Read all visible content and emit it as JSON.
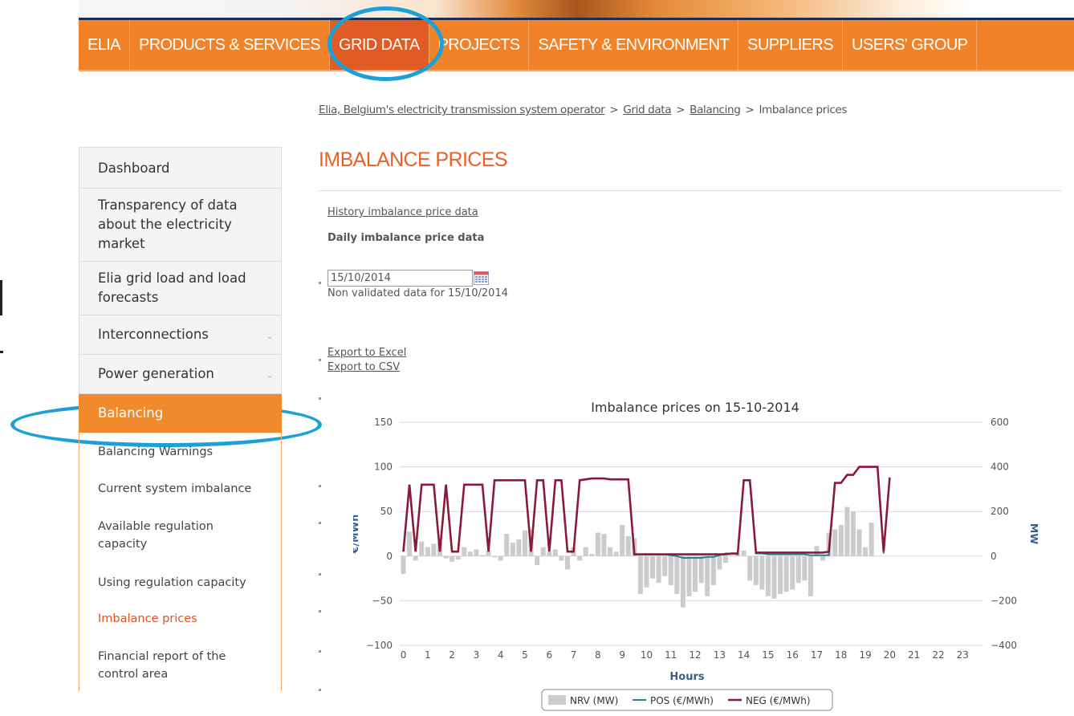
{
  "nav": {
    "items": [
      "ELIA",
      "PRODUCTS & SERVICES",
      "GRID DATA",
      "PROJECTS",
      "SAFETY & ENVIRONMENT",
      "SUPPLIERS",
      "USERS' GROUP"
    ],
    "active_index": 2
  },
  "breadcrumb": {
    "home": "Elia, Belgium's electricity transmission system operator",
    "grid_data": "Grid data",
    "balancing": "Balancing",
    "current": "Imbalance prices",
    "separator": ">"
  },
  "sidebar": {
    "top_items": [
      {
        "label": "Dashboard",
        "has_chevron": false
      },
      {
        "label": "Transparency of data about the electricity market",
        "has_chevron": false
      },
      {
        "label": "Elia grid load and load forecasts",
        "has_chevron": false
      },
      {
        "label": "Interconnections",
        "has_chevron": true
      },
      {
        "label": "Power generation",
        "has_chevron": true
      }
    ],
    "active": "Balancing",
    "sub_items": [
      {
        "label": "Balancing Warnings",
        "current": false
      },
      {
        "label": "Current system imbalance",
        "current": false
      },
      {
        "label": "Available regulation capacity",
        "current": false
      },
      {
        "label": "Using regulation capacity",
        "current": false
      },
      {
        "label": "Imbalance prices",
        "current": true
      },
      {
        "label": "Financial report of the control area",
        "current": false
      }
    ]
  },
  "content": {
    "title": "IMBALANCE PRICES",
    "history_link": "History imbalance price data",
    "daily_label": "Daily imbalance price data",
    "date_value": "15/10/2014",
    "status_text": "Non validated data for 15/10/2014",
    "export_excel": "Export to Excel",
    "export_csv": "Export to CSV"
  },
  "chart_data": {
    "type": "bar",
    "title": "Imbalance prices on 15-10-2014",
    "xlabel": "Hours",
    "ylabel_left": "€/MWh",
    "ylabel_right": "MW",
    "y_left_ticks": [
      150,
      100,
      50,
      0,
      -50,
      -100
    ],
    "y_right_ticks": [
      600,
      400,
      200,
      0,
      -200,
      -400
    ],
    "ylim_left": [
      -100,
      150
    ],
    "ylim_right": [
      -400,
      600
    ],
    "x_ticks": [
      0,
      1,
      2,
      3,
      4,
      5,
      6,
      7,
      8,
      9,
      10,
      11,
      12,
      13,
      14,
      15,
      16,
      17,
      18,
      19,
      20,
      21,
      22,
      23
    ],
    "x_range": [
      -0.15,
      23.85
    ],
    "legend_position": "bottom",
    "colors": {
      "nrv": "#cccccc",
      "pos": "#2b7f8e",
      "neg": "#8b1a38"
    },
    "series": [
      {
        "name": "NRV (MW)",
        "kind": "bar",
        "axis": "right",
        "values": [
          -80,
          110,
          -20,
          65,
          40,
          55,
          60,
          -10,
          -25,
          -15,
          40,
          20,
          30,
          5,
          25,
          -5,
          -20,
          100,
          60,
          75,
          115,
          120,
          -40,
          40,
          20,
          30,
          -20,
          -60,
          40,
          -20,
          40,
          10,
          105,
          100,
          40,
          20,
          140,
          90,
          80,
          -170,
          -140,
          -100,
          -120,
          -90,
          -130,
          -170,
          -230,
          -180,
          -160,
          -120,
          -180,
          -130,
          -60,
          -30,
          5,
          10,
          25,
          -110,
          -130,
          -150,
          -180,
          -190,
          -170,
          -160,
          -150,
          -120,
          -110,
          -180,
          45,
          -20,
          105,
          120,
          140,
          220,
          200,
          120,
          40,
          150
        ]
      },
      {
        "name": "POS (€/MWh)",
        "kind": "line",
        "axis": "left",
        "values": [
          5,
          80,
          5,
          80,
          80,
          80,
          5,
          80,
          5,
          5,
          80,
          80,
          80,
          80,
          5,
          85,
          85,
          85,
          85,
          85,
          85,
          5,
          85,
          85,
          5,
          85,
          85,
          5,
          5,
          85,
          86,
          87,
          87,
          87,
          86,
          86,
          86,
          86,
          2,
          2,
          2,
          2,
          2,
          2,
          1,
          0,
          -2,
          -2,
          -2,
          -2,
          -1,
          -1,
          1,
          3,
          3,
          2,
          85,
          85,
          3,
          3,
          2,
          2,
          2,
          2,
          2,
          2,
          2,
          1,
          1,
          1,
          1,
          82,
          82,
          91,
          91,
          100,
          100,
          100,
          100,
          3,
          88
        ]
      },
      {
        "name": "NEG (€/MWh)",
        "kind": "line",
        "axis": "left",
        "values": [
          5,
          80,
          5,
          80,
          80,
          80,
          5,
          80,
          5,
          5,
          80,
          80,
          80,
          80,
          5,
          85,
          85,
          85,
          85,
          85,
          85,
          5,
          85,
          85,
          5,
          85,
          85,
          5,
          5,
          85,
          86,
          87,
          87,
          87,
          86,
          86,
          86,
          86,
          2,
          2,
          2,
          2,
          2,
          2,
          2,
          2,
          2,
          2,
          2,
          2,
          2,
          2,
          2,
          2,
          3,
          3,
          85,
          85,
          4,
          4,
          4,
          4,
          4,
          4,
          4,
          4,
          4,
          4,
          4,
          4,
          5,
          82,
          82,
          91,
          91,
          100,
          100,
          100,
          100,
          5,
          88
        ]
      }
    ]
  }
}
